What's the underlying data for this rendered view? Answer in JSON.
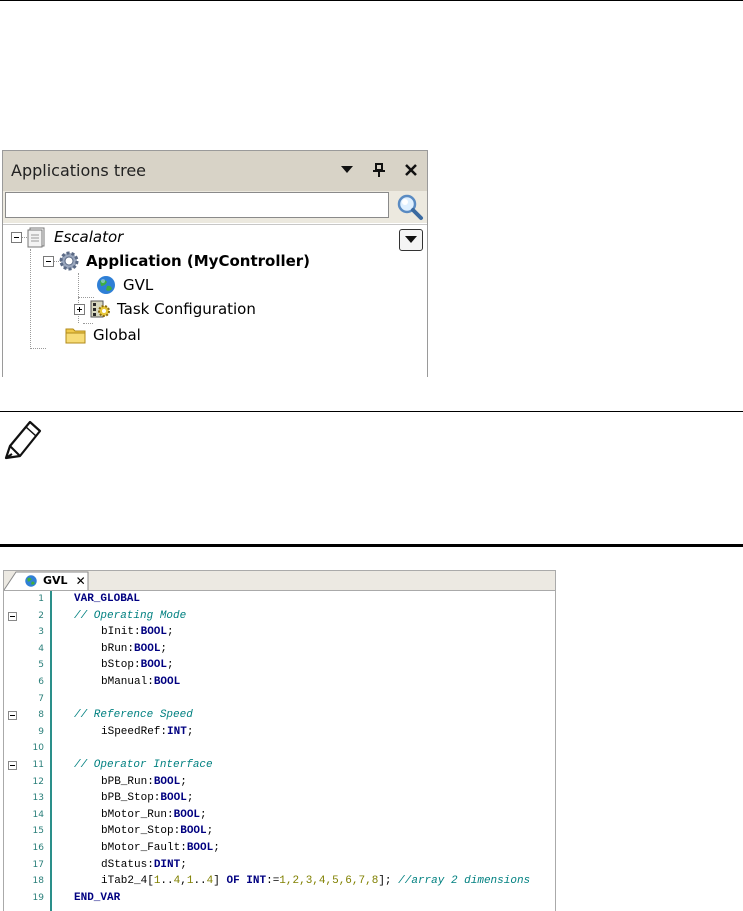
{
  "applications_tree": {
    "title": "Applications tree",
    "search_placeholder": "",
    "nodes": [
      {
        "label": "Escalator",
        "icon": "document-icon",
        "style": "italic"
      },
      {
        "label": "Application (MyController)",
        "icon": "gear-icon",
        "style": "bold"
      },
      {
        "label": "GVL",
        "icon": "globe-icon",
        "style": "normal"
      },
      {
        "label": "Task Configuration",
        "icon": "task-configuration-icon",
        "style": "normal"
      },
      {
        "label": "Global",
        "icon": "folder-icon",
        "style": "normal"
      }
    ]
  },
  "editor": {
    "tab_label": "GVL",
    "line_numbers": [
      "1",
      "2",
      "3",
      "4",
      "5",
      "6",
      "7",
      "8",
      "9",
      "10",
      "11",
      "12",
      "13",
      "14",
      "15",
      "16",
      "17",
      "18",
      "19"
    ],
    "lines": {
      "l1_kw": "VAR_GLOBAL",
      "l2_cm": "// Operating Mode",
      "l3_id": "bInit:",
      "l3_kw": "BOOL",
      "l3_end": ";",
      "l4_id": "bRun:",
      "l4_kw": "BOOL",
      "l4_end": ";",
      "l5_id": "bStop:",
      "l5_kw": "BOOL",
      "l5_end": ";",
      "l6_id": "bManual:",
      "l6_kw": "BOOL",
      "l8_cm": "// Reference Speed",
      "l9_id": "iSpeedRef:",
      "l9_kw": "INT",
      "l9_end": ";",
      "l11_cm": "// Operator Interface",
      "l12_id": "bPB_Run:",
      "l12_kw": "BOOL",
      "l12_end": ";",
      "l13_id": "bPB_Stop:",
      "l13_kw": "BOOL",
      "l13_end": ";",
      "l14_id": "bMotor_Run:",
      "l14_kw": "BOOL",
      "l14_end": ";",
      "l15_id": "bMotor_Stop:",
      "l15_kw": "BOOL",
      "l15_end": ";",
      "l16_id": "bMotor_Fault:",
      "l16_kw": "BOOL",
      "l16_end": ";",
      "l17_id": "dStatus:",
      "l17_kw": "DINT",
      "l17_end": ";",
      "l18_a": "iTab2_4[",
      "l18_n1": "1",
      "l18_b": "..",
      "l18_n2": "4",
      "l18_c": ",",
      "l18_n3": "1",
      "l18_d": "..",
      "l18_n4": "4",
      "l18_e": "] ",
      "l18_kw1": "OF",
      "l18_sp": " ",
      "l18_kw2": "INT",
      "l18_f": ":=",
      "l18_vals": "1,2,3,4,5,6,7,8",
      "l18_g": "]; ",
      "l18_cm": "//array 2 dimensions",
      "l19_kw": "END_VAR"
    }
  }
}
